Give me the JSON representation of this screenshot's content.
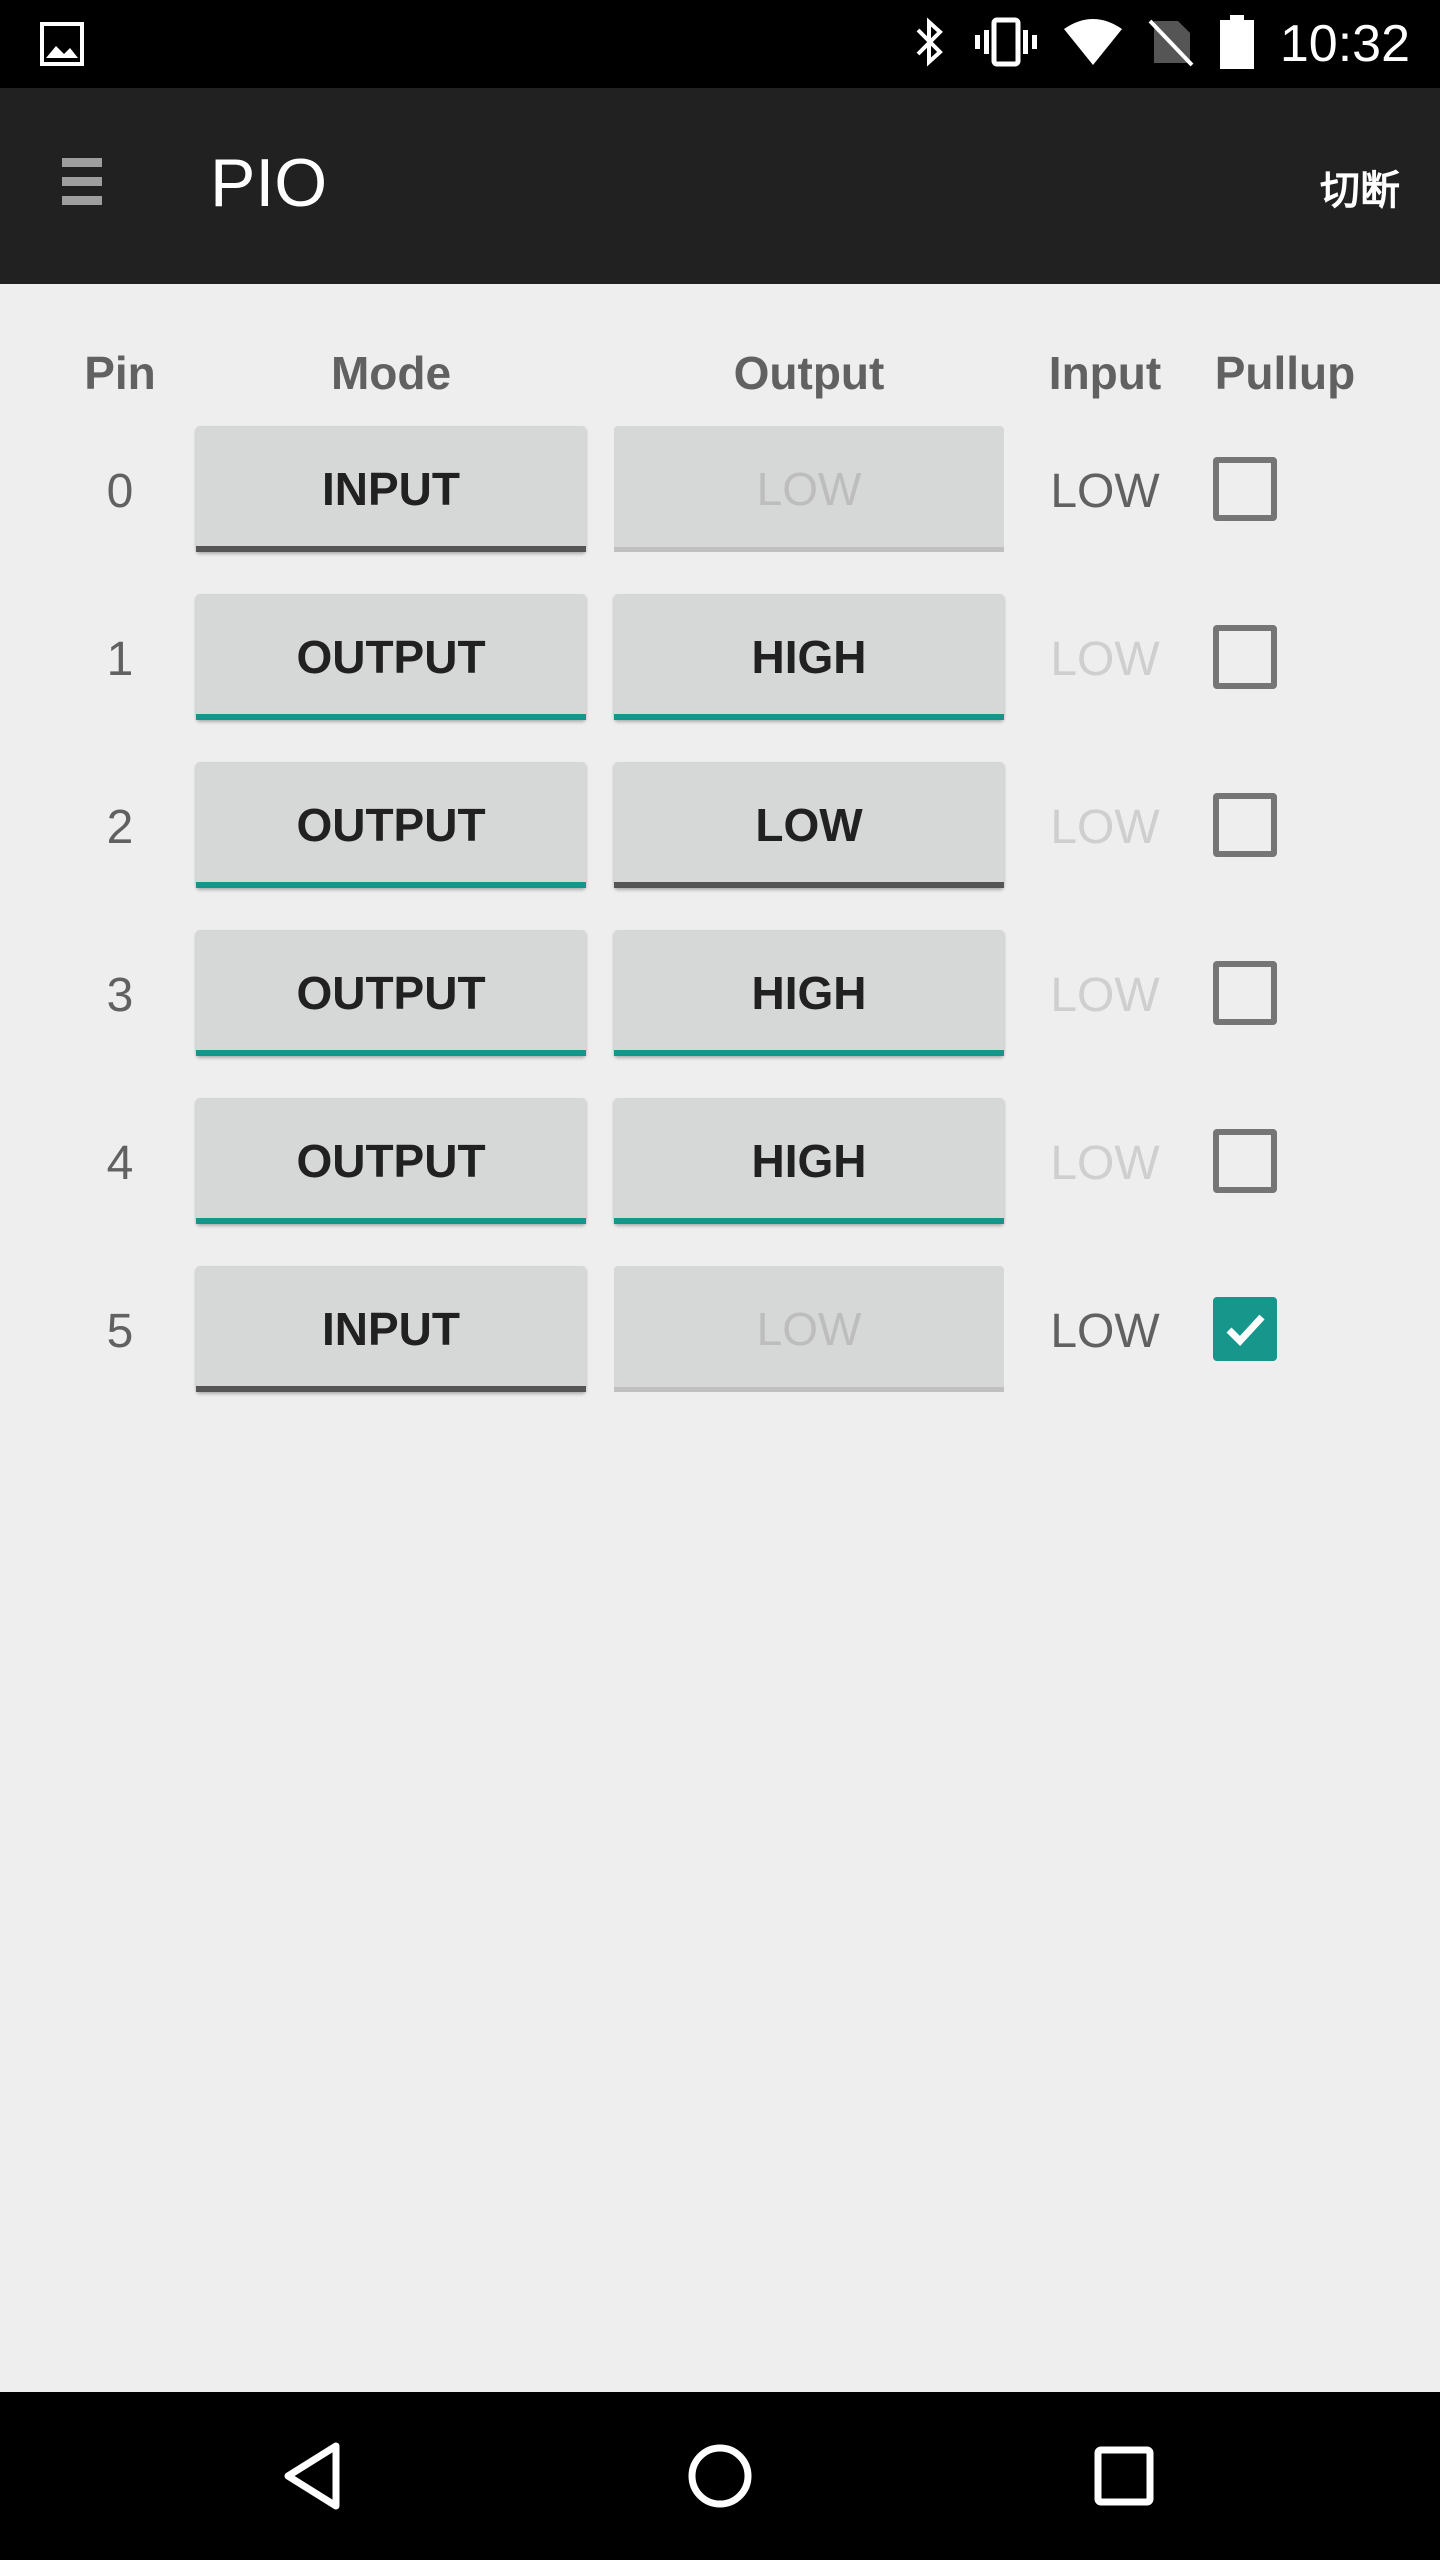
{
  "status_bar": {
    "time": "10:32",
    "icons": [
      "image-notification-icon",
      "bluetooth-icon",
      "vibrate-icon",
      "wifi-icon",
      "no-sim-icon",
      "battery-icon"
    ]
  },
  "app_bar": {
    "title": "PIO",
    "action_label": "切断",
    "menu_icon": "hamburger-menu-icon"
  },
  "table": {
    "headers": {
      "pin": "Pin",
      "mode": "Mode",
      "output": "Output",
      "input": "Input",
      "pullup": "Pullup"
    },
    "rows": [
      {
        "pin": "0",
        "mode": "INPUT",
        "output": "LOW",
        "input": "LOW",
        "pullup": false
      },
      {
        "pin": "1",
        "mode": "OUTPUT",
        "output": "HIGH",
        "input": "LOW",
        "pullup": false
      },
      {
        "pin": "2",
        "mode": "OUTPUT",
        "output": "LOW",
        "input": "LOW",
        "pullup": false
      },
      {
        "pin": "3",
        "mode": "OUTPUT",
        "output": "HIGH",
        "input": "LOW",
        "pullup": false
      },
      {
        "pin": "4",
        "mode": "OUTPUT",
        "output": "HIGH",
        "input": "LOW",
        "pullup": false
      },
      {
        "pin": "5",
        "mode": "INPUT",
        "output": "LOW",
        "input": "LOW",
        "pullup": true
      }
    ]
  },
  "colors": {
    "accent": "#16968a",
    "app_bar": "#212121",
    "background": "#eeeeee"
  },
  "nav_bar": {
    "icons": [
      "back-icon",
      "home-icon",
      "recents-icon"
    ]
  }
}
